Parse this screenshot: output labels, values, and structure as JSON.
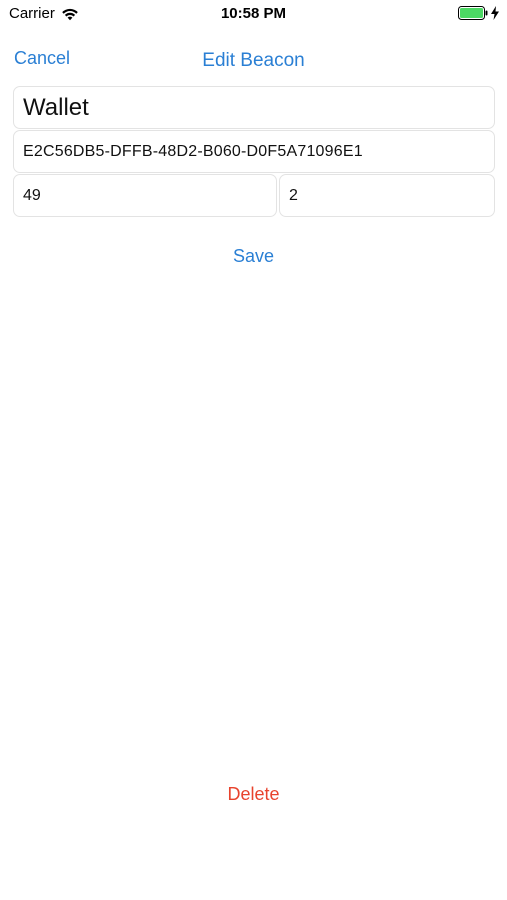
{
  "status_bar": {
    "carrier": "Carrier",
    "time": "10:58 PM",
    "icons": [
      "wifi-icon",
      "battery-icon",
      "charging-bolt-icon"
    ],
    "battery_color": "#4cd964"
  },
  "nav": {
    "cancel_label": "Cancel",
    "title": "Edit Beacon"
  },
  "form": {
    "name_value": "Wallet",
    "uuid_value": "E2C56DB5-DFFB-48D2-B060-D0F5A71096E1",
    "major_value": "49",
    "minor_value": "2"
  },
  "actions": {
    "save_label": "Save",
    "delete_label": "Delete"
  },
  "colors": {
    "accent": "#2a7fd4",
    "destructive": "#e8432d",
    "field_border": "#e3e3e3"
  }
}
